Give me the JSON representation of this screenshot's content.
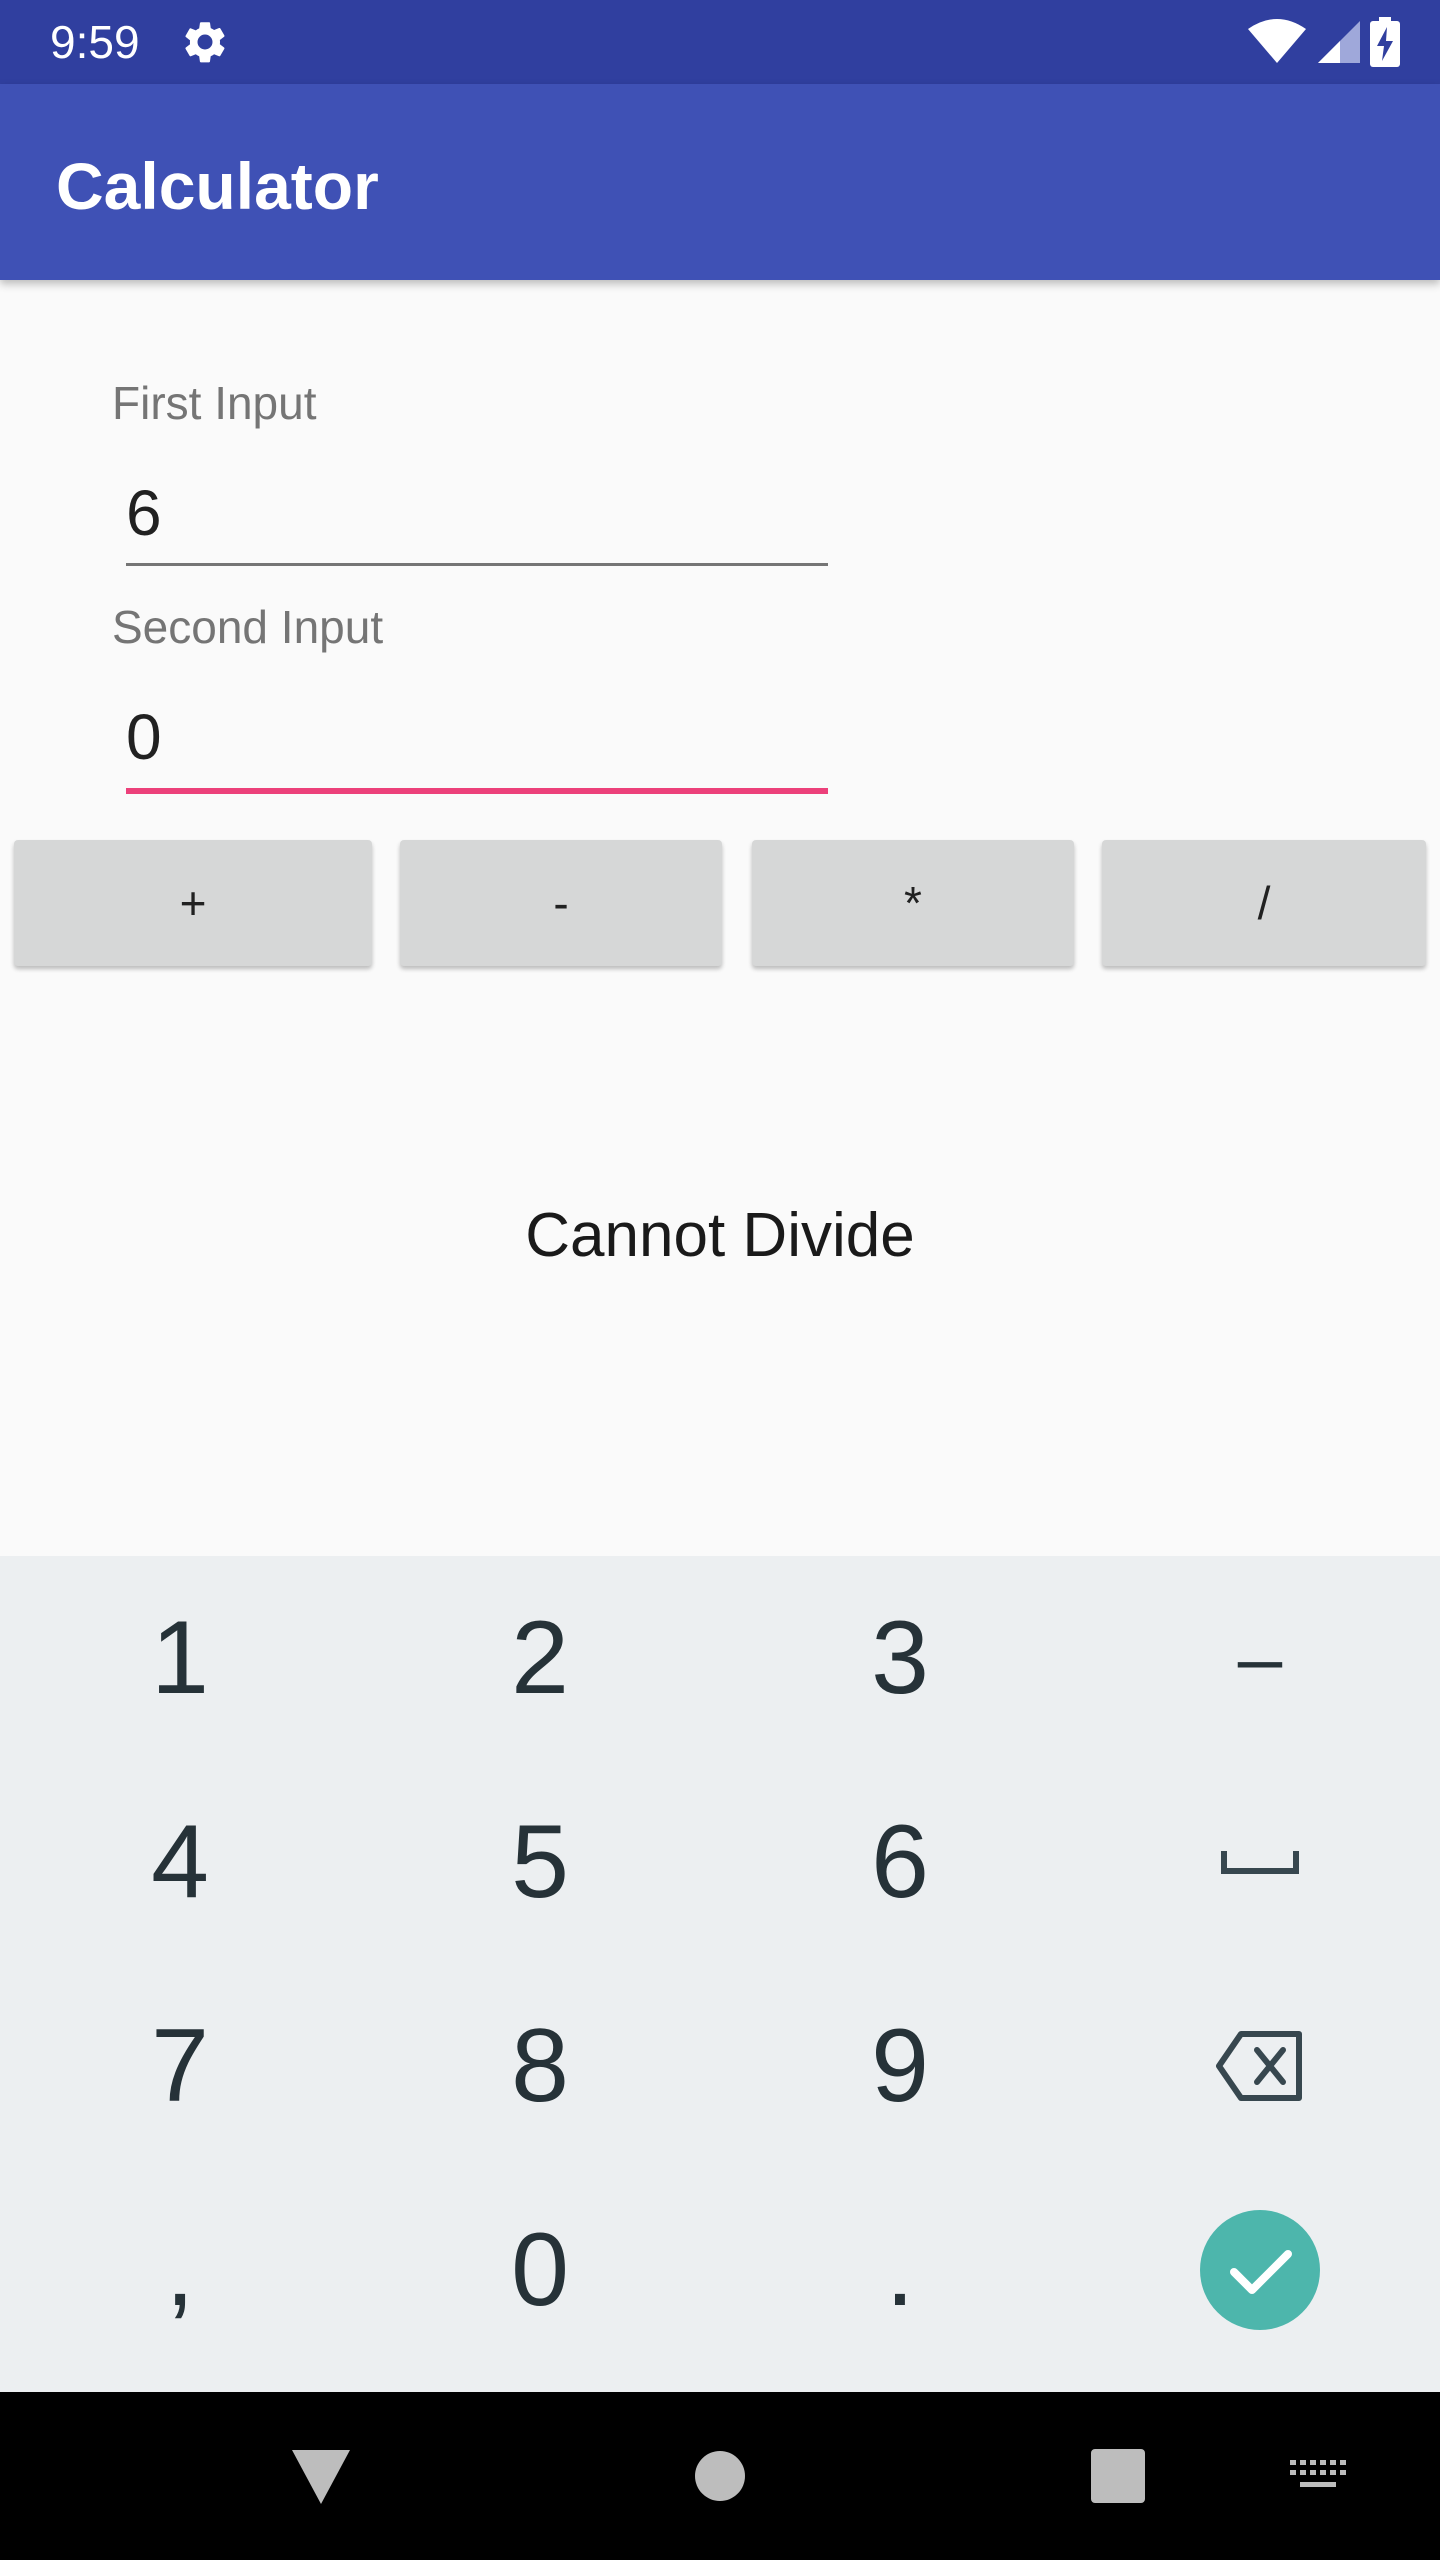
{
  "status_bar": {
    "time": "9:59",
    "icons": [
      "settings-gear-icon",
      "wifi-icon",
      "cell-signal-icon",
      "battery-charging-icon"
    ]
  },
  "app_bar": {
    "title": "Calculator"
  },
  "form": {
    "first_label": "First Input",
    "first_value": "6",
    "second_label": "Second Input",
    "second_value": "0"
  },
  "operators": [
    "+",
    "-",
    "*",
    "/"
  ],
  "result": "Cannot Divide",
  "keyboard": {
    "rows": [
      [
        "1",
        "2",
        "3",
        "–"
      ],
      [
        "4",
        "5",
        "6",
        "space-icon"
      ],
      [
        "7",
        "8",
        "9",
        "backspace-icon"
      ],
      [
        ",",
        "0",
        ".",
        "done-check-icon"
      ]
    ]
  },
  "colors": {
    "status_bar": "#303f9f",
    "app_bar": "#3f51b5",
    "accent": "#ec407a",
    "done_button": "#4db6ac",
    "keyboard_bg": "#eceff1"
  },
  "navigation_bar": {
    "icons": [
      "back-icon",
      "home-icon",
      "recents-icon",
      "keyboard-switch-icon"
    ]
  }
}
